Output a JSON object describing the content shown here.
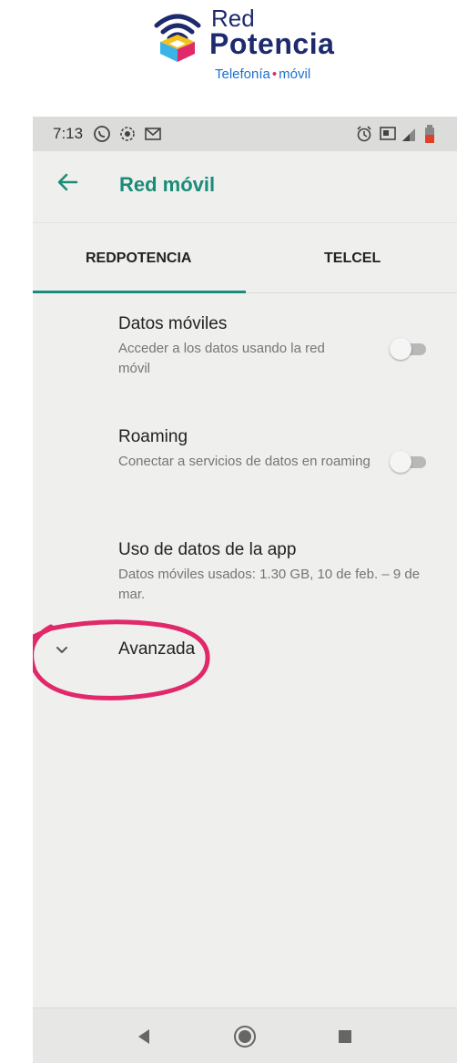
{
  "brand": {
    "name_line1": "Red",
    "name_line2": "Potencia",
    "tagline_part1": "Telefonía",
    "tagline_sep": "•",
    "tagline_part2": "móvil"
  },
  "status_bar": {
    "time": "7:13",
    "icons": [
      "whatsapp-icon",
      "screen-record-icon",
      "gmail-icon",
      "alarm-icon",
      "cast-icon",
      "signal-icon",
      "battery-icon"
    ]
  },
  "app_bar": {
    "title": "Red móvil",
    "back_icon": "arrow-left-icon"
  },
  "tabs": [
    {
      "label": "REDPOTENCIA",
      "selected": true
    },
    {
      "label": "TELCEL",
      "selected": false
    }
  ],
  "preferences": [
    {
      "title": "Datos móviles",
      "summary": "Acceder a los datos usando la red móvil",
      "switch_on": false
    },
    {
      "title": "Roaming",
      "summary": "Conectar a servicios de datos en roaming",
      "switch_on": false
    },
    {
      "title": "Uso de datos de la app",
      "summary": "Datos móviles usados: 1.30 GB, 10 de feb. – 9 de mar."
    }
  ],
  "advanced": {
    "label": "Avanzada",
    "icon": "chevron-down-icon"
  },
  "nav_bar": {
    "buttons": [
      "back-triangle-icon",
      "home-circle-icon",
      "recents-square-icon"
    ]
  },
  "colors": {
    "accent": "#1a8c79",
    "brand_dark": "#1e2a6e",
    "brand_blue": "#1e6fd0",
    "annotation": "#e0286a"
  }
}
